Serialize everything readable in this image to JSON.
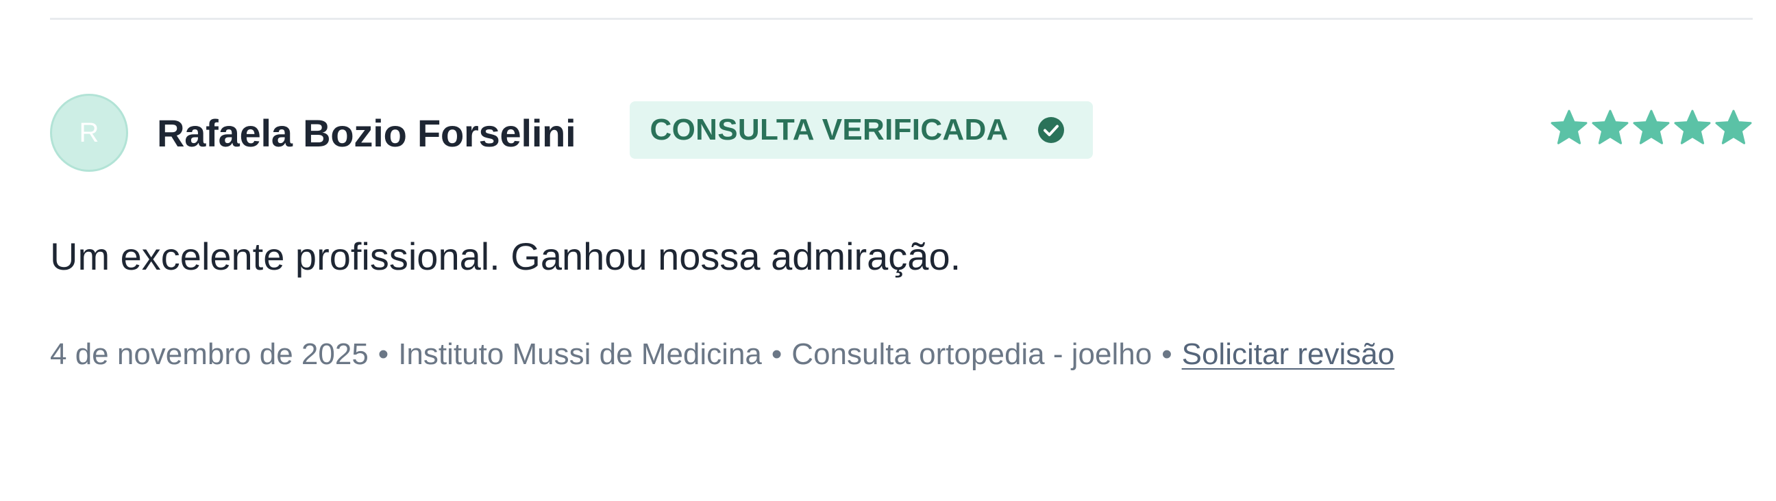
{
  "review": {
    "avatar_initial": "R",
    "reviewer_name": "Rafaela Bozio Forselini",
    "badge_label": "CONSULTA VERIFICADA",
    "badge_icon": "check-circle-icon",
    "rating": 5,
    "rating_max": 5,
    "text": "Um excelente profissional. Ganhou nossa admiração.",
    "date": "4 de novembro de 2025",
    "separator": "•",
    "location": "Instituto Mussi de Medicina",
    "service": "Consulta ortopedia - joelho",
    "request_revision_label": "Solicitar revisão"
  },
  "colors": {
    "accent": "#5bc2a6",
    "badge_bg": "#e3f6f1",
    "badge_text": "#2a7259",
    "avatar_bg": "#cdeee5"
  }
}
